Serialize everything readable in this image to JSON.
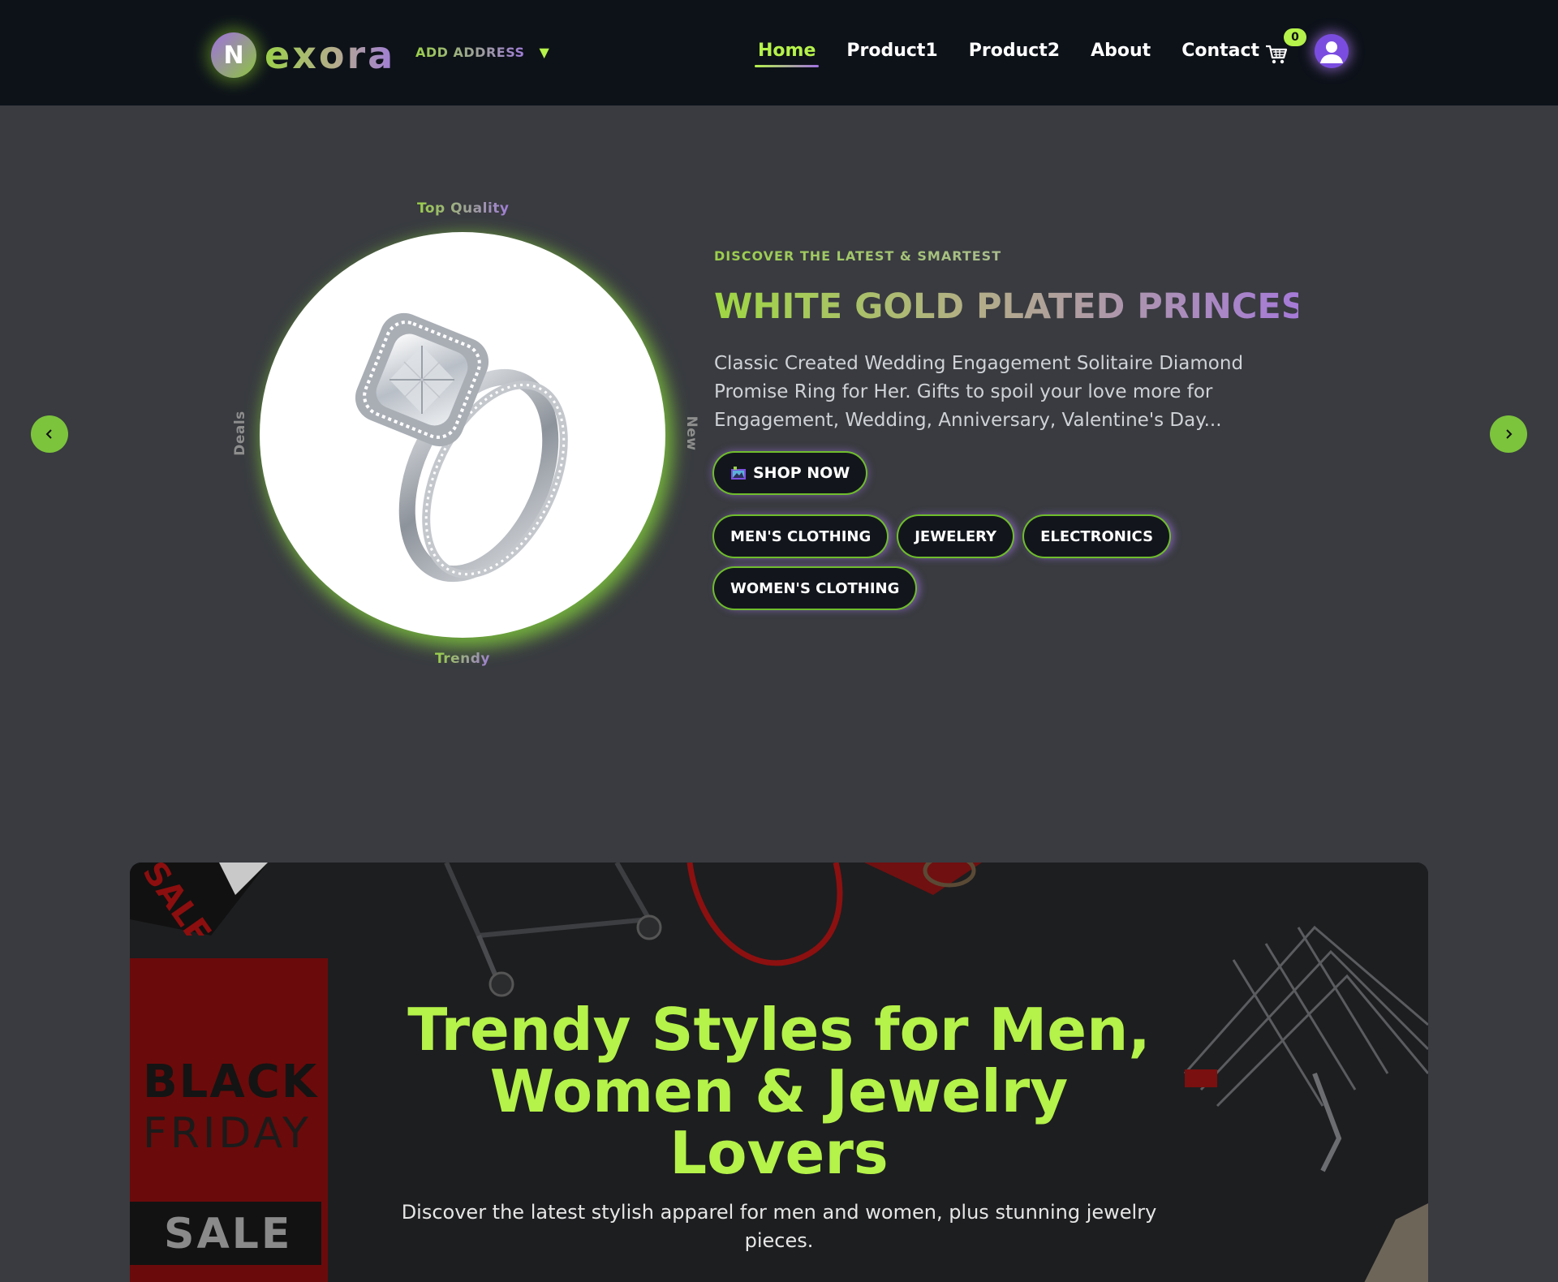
{
  "header": {
    "logo_letter": "N",
    "logo_text": "exora",
    "address_label": "ADD ADDRESS",
    "address_caret": "▼",
    "nav": [
      "Home",
      "Product1",
      "Product2",
      "About",
      "Contact"
    ],
    "active_nav": "Home",
    "cart_count": "0"
  },
  "hero": {
    "labels": {
      "top": "Top Quality",
      "bottom": "Trendy",
      "left": "Deals",
      "right": "New"
    },
    "eyebrow": "DISCOVER THE LATEST & SMARTEST",
    "title": "WHITE GOLD PLATED PRINCESS",
    "description": "Classic Created Wedding Engagement Solitaire Diamond Promise Ring for Her. Gifts to spoil your love more for Engagement, Wedding, Anniversary, Valentine's Day...",
    "shop_button": "SHOP NOW",
    "categories": [
      "MEN'S CLOTHING",
      "JEWELERY",
      "ELECTRONICS",
      "WOMEN'S CLOTHING"
    ],
    "prev_icon": "chevron-left-icon",
    "next_icon": "chevron-right-icon"
  },
  "banner": {
    "title": "Trendy Styles for Men, Women & Jewelry Lovers",
    "subtitle": "Discover the latest stylish apparel for men and women, plus stunning jewelry pieces.",
    "promo": {
      "line1": "BLACK",
      "line2": "FRIDAY",
      "line3": "SALE",
      "corner": "SALE"
    }
  },
  "colors": {
    "accent_green": "#b5f24a",
    "accent_purple": "#a070e0",
    "header_bg": "#0d1219",
    "page_bg": "#393b40"
  }
}
